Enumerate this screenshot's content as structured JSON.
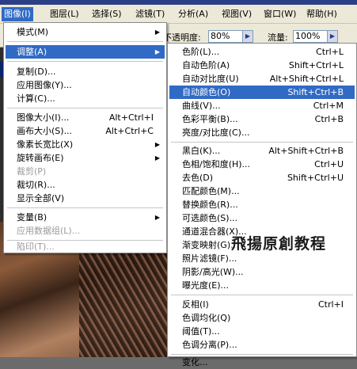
{
  "menubar": {
    "items": [
      "图像(I)",
      "图层(L)",
      "选择(S)",
      "滤镜(T)",
      "分析(A)",
      "视图(V)",
      "窗口(W)",
      "帮助(H)"
    ]
  },
  "options": {
    "opacity_label": "不透明度:",
    "opacity_value": "80%",
    "flow_label": "流量:",
    "flow_value": "100%"
  },
  "image_menu": {
    "items": [
      {
        "label": "模式(M)",
        "shortcut": ""
      },
      {
        "label": "调整(A)",
        "shortcut": ""
      },
      {
        "label": "复制(D)...",
        "shortcut": ""
      },
      {
        "label": "应用图像(Y)...",
        "shortcut": ""
      },
      {
        "label": "计算(C)...",
        "shortcut": ""
      },
      {
        "label": "图像大小(I)...",
        "shortcut": "Alt+Ctrl+I"
      },
      {
        "label": "画布大小(S)...",
        "shortcut": "Alt+Ctrl+C"
      },
      {
        "label": "像素长宽比(X)",
        "shortcut": ""
      },
      {
        "label": "旋转画布(E)",
        "shortcut": ""
      },
      {
        "label": "裁剪(P)",
        "shortcut": ""
      },
      {
        "label": "裁切(R)...",
        "shortcut": ""
      },
      {
        "label": "显示全部(V)",
        "shortcut": ""
      },
      {
        "label": "变量(B)",
        "shortcut": ""
      },
      {
        "label": "应用数据组(L)...",
        "shortcut": ""
      },
      {
        "label": "陷印(T)...",
        "shortcut": ""
      }
    ]
  },
  "adjust_menu": {
    "items": [
      {
        "label": "色阶(L)...",
        "shortcut": "Ctrl+L"
      },
      {
        "label": "自动色阶(A)",
        "shortcut": "Shift+Ctrl+L"
      },
      {
        "label": "自动对比度(U)",
        "shortcut": "Alt+Shift+Ctrl+L"
      },
      {
        "label": "自动颜色(O)",
        "shortcut": "Shift+Ctrl+B"
      },
      {
        "label": "曲线(V)...",
        "shortcut": "Ctrl+M"
      },
      {
        "label": "色彩平衡(B)...",
        "shortcut": "Ctrl+B"
      },
      {
        "label": "亮度/对比度(C)...",
        "shortcut": ""
      },
      {
        "label": "黑白(K)...",
        "shortcut": "Alt+Shift+Ctrl+B"
      },
      {
        "label": "色相/饱和度(H)...",
        "shortcut": "Ctrl+U"
      },
      {
        "label": "去色(D)",
        "shortcut": "Shift+Ctrl+U"
      },
      {
        "label": "匹配颜色(M)...",
        "shortcut": ""
      },
      {
        "label": "替换颜色(R)...",
        "shortcut": ""
      },
      {
        "label": "可选颜色(S)...",
        "shortcut": ""
      },
      {
        "label": "通道混合器(X)...",
        "shortcut": ""
      },
      {
        "label": "渐变映射(G)...",
        "shortcut": ""
      },
      {
        "label": "照片滤镜(F)...",
        "shortcut": ""
      },
      {
        "label": "阴影/高光(W)...",
        "shortcut": ""
      },
      {
        "label": "曝光度(E)...",
        "shortcut": ""
      },
      {
        "label": "反相(I)",
        "shortcut": "Ctrl+I"
      },
      {
        "label": "色调均化(Q)",
        "shortcut": ""
      },
      {
        "label": "阈值(T)...",
        "shortcut": ""
      },
      {
        "label": "色调分离(P)...",
        "shortcut": ""
      },
      {
        "label": "变化...",
        "shortcut": ""
      }
    ]
  },
  "watermark": "飛揚原創教程",
  "colors": {
    "highlight": "#316ac5",
    "menubar": "#ece9d8",
    "titlebar": "#2b3f86"
  }
}
